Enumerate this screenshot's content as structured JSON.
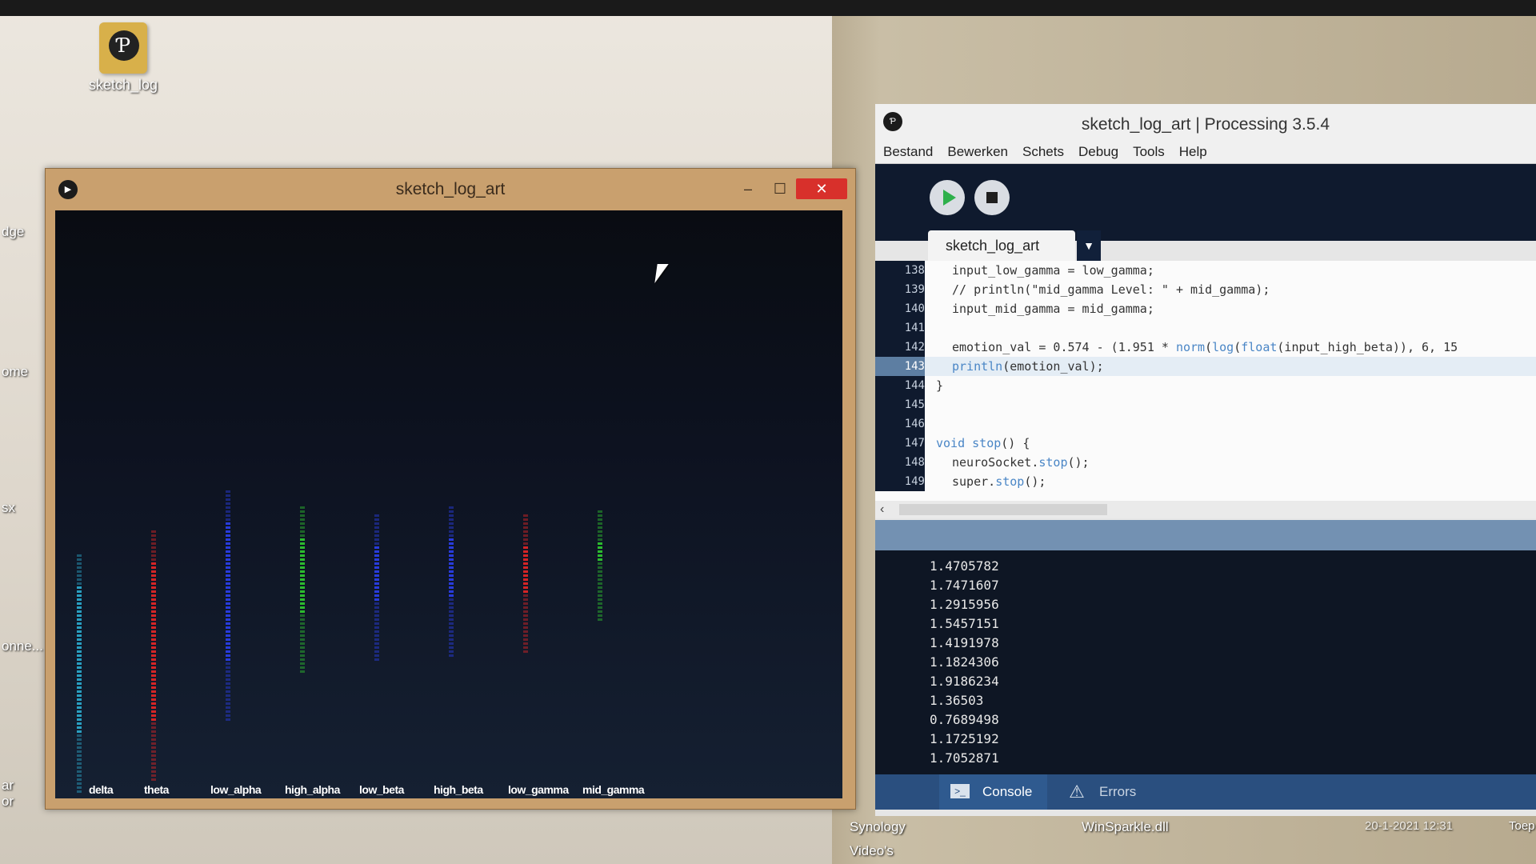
{
  "desktop": {
    "icon_label": "sketch_log",
    "edge_fragments": [
      "dge",
      "ome",
      "sx",
      "onne...",
      "ar",
      "or"
    ],
    "files": [
      {
        "name": "Synology"
      },
      {
        "name": "Video's"
      },
      {
        "name": "WinSparkle.dll",
        "date": "20-1-2021 12:31",
        "extra": "Toep"
      }
    ]
  },
  "sketch_window": {
    "title": "sketch_log_art",
    "minimize": "–",
    "maximize": "☐",
    "close": "✕",
    "bands": [
      "delta",
      "theta",
      "low_alpha",
      "high_alpha",
      "low_beta",
      "high_beta",
      "low_gamma",
      "mid_gamma"
    ],
    "band_colors": [
      "#2aa6c9",
      "#e02626",
      "#2a3ee6",
      "#2ec42e",
      "#2a3ee6",
      "#2a3ee6",
      "#e02626",
      "#2ec42e"
    ]
  },
  "ide": {
    "title": "sketch_log_art | Processing 3.5.4",
    "menu": [
      "Bestand",
      "Bewerken",
      "Schets",
      "Debug",
      "Tools",
      "Help"
    ],
    "tab_label": "sketch_log_art",
    "tab_dropdown": "▼",
    "code_lines": [
      {
        "num": "138",
        "text": "input_low_gamma = low_gamma;"
      },
      {
        "num": "139",
        "text": "// println(\"mid_gamma Level: \" + mid_gamma);"
      },
      {
        "num": "140",
        "text": "input_mid_gamma = mid_gamma;"
      },
      {
        "num": "141",
        "text": ""
      },
      {
        "num": "142",
        "text": "emotion_val = 0.574 - (1.951 * norm(log(float(input_high_beta)), 6, 15"
      },
      {
        "num": "143",
        "text": "println(emotion_val);"
      },
      {
        "num": "144",
        "text": "}"
      },
      {
        "num": "145",
        "text": ""
      },
      {
        "num": "146",
        "text": ""
      },
      {
        "num": "147",
        "text": "void stop() {"
      },
      {
        "num": "148",
        "text": "neuroSocket.stop();"
      },
      {
        "num": "149",
        "text": "super.stop();"
      }
    ],
    "current_line": "143",
    "console_output": [
      "1.4705782",
      "1.7471607",
      "1.2915956",
      "1.5457151",
      "1.4191978",
      "1.1824306",
      "1.9186234",
      "1.36503",
      "0.7689498",
      "1.1725192",
      "1.7052871"
    ],
    "console_tab": "Console",
    "errors_tab": "Errors"
  }
}
